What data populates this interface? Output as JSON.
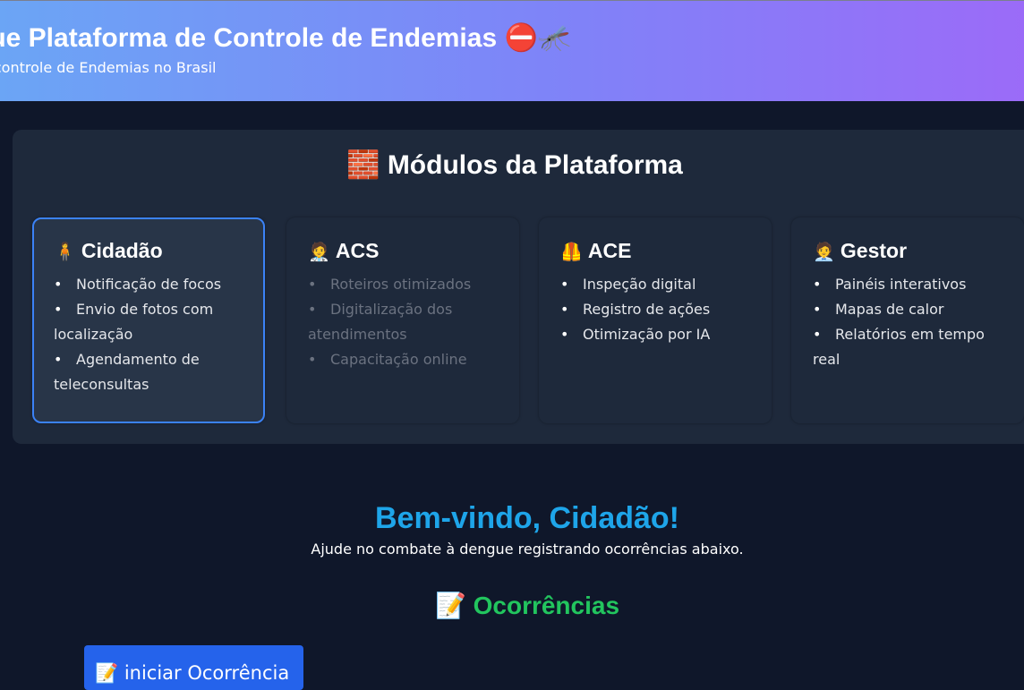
{
  "header": {
    "title": "gue Plataforma de Controle de Endemias ⛔🦟",
    "subtitle": "o controle de Endemias no Brasil"
  },
  "modules": {
    "title": "🧱 Módulos da Plataforma",
    "cards": [
      {
        "icon": "🧍",
        "title": "Cidadão",
        "items": [
          "Notificação de focos",
          "Envio de fotos com localização",
          "Agendamento de teleconsultas"
        ]
      },
      {
        "icon": "🧑‍⚕️",
        "title": "ACS",
        "items": [
          "Roteiros otimizados",
          "Digitalização dos atendimentos",
          "Capacitação online"
        ]
      },
      {
        "icon": "🦺",
        "title": "ACE",
        "items": [
          "Inspeção digital",
          "Registro de ações",
          "Otimização por IA"
        ]
      },
      {
        "icon": "🧑‍💼",
        "title": "Gestor",
        "items": [
          "Painéis interativos",
          "Mapas de calor",
          "Relatórios em tempo real"
        ]
      }
    ]
  },
  "welcome": {
    "title": "Bem-vindo, Cidadão!",
    "subtitle": "Ajude no combate à dengue registrando ocorrências abaixo."
  },
  "occurrences": {
    "title": "📝 Ocorrências",
    "start_button": "📝 iniciar Ocorrência"
  },
  "colors": {
    "background": "#0f172a",
    "panel": "#1e293b",
    "accent_blue": "#1ea5e9",
    "accent_green": "#22c55e",
    "button": "#2563eb",
    "active_border": "#3b82f6"
  }
}
